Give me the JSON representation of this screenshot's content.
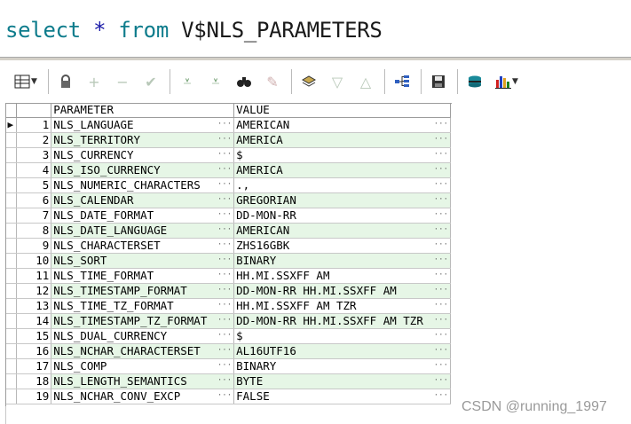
{
  "editor": {
    "kw_select": "select",
    "star": "*",
    "kw_from": "from",
    "object": "V$NLS_PARAMETERS"
  },
  "toolbar": {
    "icons": [
      "grid-layout-icon",
      "lock-icon",
      "add-record-icon",
      "delete-record-icon",
      "post-record-icon",
      "fetch-next-icon",
      "fetch-last-icon",
      "find-icon",
      "clear-record-icon",
      "query-by-example-icon",
      "sort-down-icon",
      "sort-up-icon",
      "explain-plan-icon",
      "save-icon",
      "export-icon",
      "chart-icon"
    ]
  },
  "grid": {
    "columns": [
      "PARAMETER",
      "VALUE"
    ],
    "rows": [
      {
        "n": "1",
        "p": "NLS_LANGUAGE",
        "v": "AMERICAN"
      },
      {
        "n": "2",
        "p": "NLS_TERRITORY",
        "v": "AMERICA"
      },
      {
        "n": "3",
        "p": "NLS_CURRENCY",
        "v": "$"
      },
      {
        "n": "4",
        "p": "NLS_ISO_CURRENCY",
        "v": "AMERICA"
      },
      {
        "n": "5",
        "p": "NLS_NUMERIC_CHARACTERS",
        "v": ".,"
      },
      {
        "n": "6",
        "p": "NLS_CALENDAR",
        "v": "GREGORIAN"
      },
      {
        "n": "7",
        "p": "NLS_DATE_FORMAT",
        "v": "DD-MON-RR"
      },
      {
        "n": "8",
        "p": "NLS_DATE_LANGUAGE",
        "v": "AMERICAN"
      },
      {
        "n": "9",
        "p": "NLS_CHARACTERSET",
        "v": "ZHS16GBK"
      },
      {
        "n": "10",
        "p": "NLS_SORT",
        "v": "BINARY"
      },
      {
        "n": "11",
        "p": "NLS_TIME_FORMAT",
        "v": "HH.MI.SSXFF AM"
      },
      {
        "n": "12",
        "p": "NLS_TIMESTAMP_FORMAT",
        "v": "DD-MON-RR HH.MI.SSXFF AM"
      },
      {
        "n": "13",
        "p": "NLS_TIME_TZ_FORMAT",
        "v": "HH.MI.SSXFF AM TZR"
      },
      {
        "n": "14",
        "p": "NLS_TIMESTAMP_TZ_FORMAT",
        "v": "DD-MON-RR HH.MI.SSXFF AM TZR"
      },
      {
        "n": "15",
        "p": "NLS_DUAL_CURRENCY",
        "v": "$"
      },
      {
        "n": "16",
        "p": "NLS_NCHAR_CHARACTERSET",
        "v": "AL16UTF16"
      },
      {
        "n": "17",
        "p": "NLS_COMP",
        "v": "BINARY"
      },
      {
        "n": "18",
        "p": "NLS_LENGTH_SEMANTICS",
        "v": "BYTE"
      },
      {
        "n": "19",
        "p": "NLS_NCHAR_CONV_EXCP",
        "v": "FALSE"
      }
    ]
  },
  "watermark": "CSDN @running_1997"
}
